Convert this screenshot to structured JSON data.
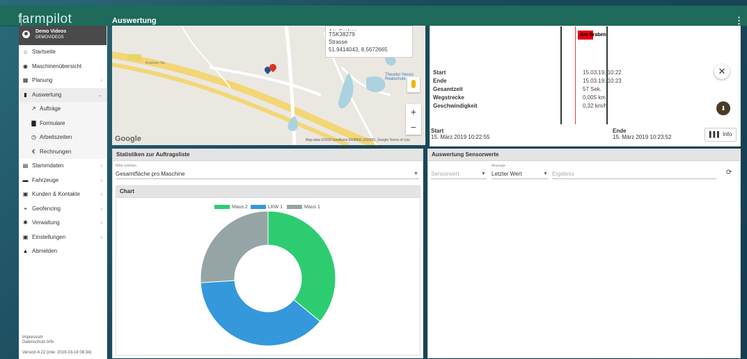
{
  "app": {
    "brand": "farmpilot",
    "page_title": "Auswertung"
  },
  "user": {
    "name": "Demo Videos",
    "account": "DEMOVIDEOS"
  },
  "sidebar": {
    "items": [
      {
        "label": "Startseite",
        "icon": "home-icon"
      },
      {
        "label": "Maschinenübersicht",
        "icon": "compass-icon"
      },
      {
        "label": "Planung",
        "icon": "table-icon",
        "has_children": true
      },
      {
        "label": "Auswertung",
        "icon": "bar-chart-icon",
        "has_children": true,
        "expanded": true
      },
      {
        "label": "Aufträge",
        "icon": "trend-icon",
        "sub": true,
        "active": true
      },
      {
        "label": "Formulare",
        "icon": "file-icon",
        "sub": true
      },
      {
        "label": "Arbeitszeiten",
        "icon": "clock-icon",
        "sub": true
      },
      {
        "label": "Rechnungen",
        "icon": "euro-icon",
        "sub": true
      },
      {
        "label": "Stammdaten",
        "icon": "database-icon",
        "has_children": true
      },
      {
        "label": "Fahrzeuge",
        "icon": "truck-icon",
        "has_children": true
      },
      {
        "label": "Kunden & Kontakte",
        "icon": "contacts-icon",
        "has_children": true
      },
      {
        "label": "Geofencing",
        "icon": "geofence-icon",
        "has_children": true
      },
      {
        "label": "Verwaltung",
        "icon": "cog-icon",
        "has_children": true
      },
      {
        "label": "Einstellungen",
        "icon": "settings-icon",
        "has_children": true
      },
      {
        "label": "Abmelden",
        "icon": "lock-icon"
      }
    ],
    "footer": {
      "impressum": "Impressum",
      "privacy": "Datenschutz-Info",
      "version": "Version 4.22 (inte: 2019-03-18 08:34)"
    }
  },
  "map": {
    "tooltip_line1": "Am Graben",
    "tooltip_line2": "TSK38279",
    "tooltip_line3": "Strasse",
    "tooltip_coords": "51.9414043, 8.5672665",
    "credit": "Map data ©2019 GeoBasis-DE/BKG (©2009), Google   Terms of Use",
    "google_logo": "Google",
    "zoom_in": "+",
    "zoom_out": "−",
    "street_labels": [
      "Krackser Str.",
      "Theodor Heuss Realschule"
    ]
  },
  "detail": {
    "bar_label": "Am Graben",
    "rows": [
      {
        "label": "Start",
        "value": "15.03.19, 10:22"
      },
      {
        "label": "Ende",
        "value": "15.03.19, 10:23"
      },
      {
        "label": "Gesamtzeit",
        "value": "57 Sek."
      },
      {
        "label": "Wegstrecke",
        "value": "0,005 km"
      },
      {
        "label": "Geschwindigkeit",
        "value": "0,32 km/h"
      }
    ],
    "start_label": "Start",
    "start_value": "15. März 2019 10:22:55",
    "end_label": "Ende",
    "end_value": "15. März 2019 10:23:52",
    "info_button": "Info"
  },
  "stats_panel": {
    "title": "Statistiken zur Auftragsliste",
    "select_label": "Bitte wählen",
    "select_value": "Gesamtfläche pro Maschine",
    "chart_title": "Chart"
  },
  "sensor_panel": {
    "title": "Auswertung Sensorwerte",
    "sensor_placeholder": "Sensorwert",
    "display_label": "Anzeige",
    "display_value": "Letzter Wert",
    "result_placeholder": "Ergebnis"
  },
  "chart_data": {
    "type": "pie",
    "donut": true,
    "title": "",
    "legend_position": "top",
    "series": [
      {
        "name": "Maus 2",
        "value": 36,
        "color": "#2ecc71"
      },
      {
        "name": "LKW 1",
        "value": 38,
        "color": "#3498db"
      },
      {
        "name": "Maus 1",
        "value": 26,
        "color": "#95a5a6"
      }
    ]
  }
}
